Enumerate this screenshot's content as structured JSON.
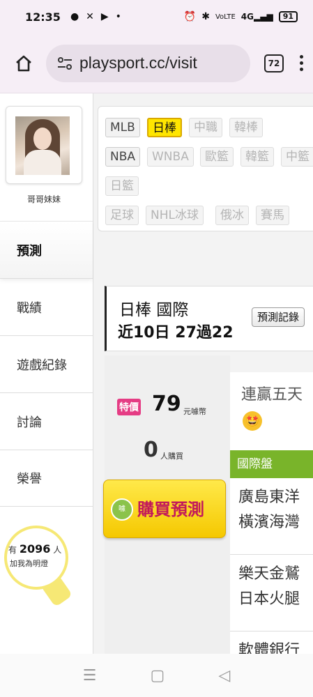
{
  "status_bar": {
    "time": "12:35",
    "battery": "91",
    "notification_icons": [
      "chat-icon",
      "fan-icon",
      "youtube-icon",
      "dot-icon"
    ],
    "system_icons": [
      "alarm-icon",
      "bluetooth-icon",
      "volte-icon",
      "signal-icon",
      "battery-icon"
    ],
    "signal_label": "4G"
  },
  "browser": {
    "url": "playsport.cc/visit",
    "tab_count": "72"
  },
  "sidebar": {
    "username": "哥哥妹妹",
    "nav": [
      {
        "label": "預測",
        "active": true
      },
      {
        "label": "戰績"
      },
      {
        "label": "遊戲紀錄"
      },
      {
        "label": "討論"
      },
      {
        "label": "榮譽"
      }
    ],
    "fans": {
      "prefix": "有",
      "count": "2096",
      "suffix": "人",
      "caption": "加我為明燈"
    }
  },
  "filters": {
    "chips": [
      {
        "label": "MLB",
        "state": "normal"
      },
      {
        "label": "日棒",
        "state": "selected"
      },
      {
        "label": "中職",
        "state": "dim"
      },
      {
        "label": "韓棒",
        "state": "dim"
      },
      {
        "label": "NBA",
        "state": "normal"
      },
      {
        "label": "WNBA",
        "state": "dim"
      },
      {
        "label": "歐籃",
        "state": "dim"
      },
      {
        "label": "韓籃",
        "state": "dim"
      },
      {
        "label": "中籃",
        "state": "dim"
      },
      {
        "label": "日籃",
        "state": "dim"
      },
      {
        "label": "足球",
        "state": "dim"
      },
      {
        "label": "NHL冰球",
        "state": "dim"
      },
      {
        "label": "俄冰",
        "state": "dim"
      },
      {
        "label": "賽馬",
        "state": "dim"
      }
    ],
    "selected_color": "#ffe600"
  },
  "prediction_header": {
    "title": "日棒 國際",
    "record": "近10日 27過22",
    "history_button": "預測記錄"
  },
  "offer": {
    "tag": "特價",
    "price": "79",
    "price_unit": "元噱幣",
    "buyers": "0",
    "buyers_unit": "人購買",
    "buy_icon_text": "噱",
    "buy_button": "購買預測"
  },
  "games": {
    "headline": "連贏五天",
    "headline_emoji": "🤩",
    "league": "國際盤",
    "league_color": "#79b42a",
    "matches": [
      {
        "home": "廣島東洋",
        "away": "橫濱海灣"
      },
      {
        "home": "樂天金鷲",
        "away": "日本火腿"
      },
      {
        "home": "軟體銀行",
        "away": ""
      }
    ]
  },
  "system_nav": {
    "recents_icon": "☰",
    "home_icon": "▢",
    "back_icon": "◁"
  }
}
